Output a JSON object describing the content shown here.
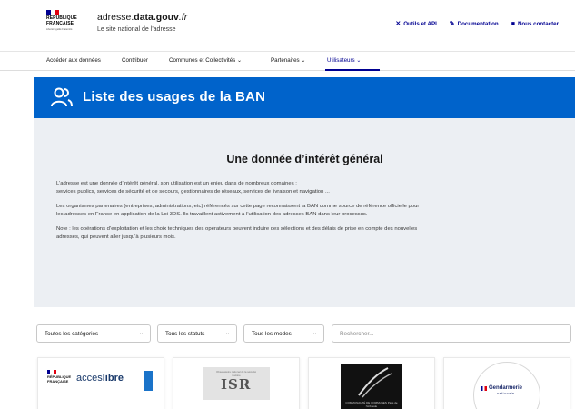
{
  "header": {
    "republic_name_line1": "RÉPUBLIQUE",
    "republic_name_line2": "FRANÇAISE",
    "motto": "Liberté Égalité Fraternité",
    "site_prefix": "adresse.",
    "site_bold": "data.gouv",
    "site_suffix": ".fr",
    "tagline": "Le site national de l'adresse",
    "links": [
      {
        "label": "Outils et API",
        "icon": "tools-icon"
      },
      {
        "label": "Documentation",
        "icon": "pen-icon"
      },
      {
        "label": "Nous contacter",
        "icon": "message-icon"
      }
    ]
  },
  "nav": {
    "items": [
      {
        "label": "Accéder aux données"
      },
      {
        "label": "Contribuer"
      },
      {
        "label": "Communes et Collectivités  ⌄"
      },
      {
        "label": "Partenaires  ⌄"
      },
      {
        "label": "Utilisateurs  ⌄"
      }
    ],
    "active_index": 4
  },
  "banner": {
    "title": "Liste des usages de la BAN",
    "icon": "users-icon",
    "color": "#0063cb"
  },
  "intro": {
    "title": "Une donnée d’intérêt général",
    "p1_line1": "L’adresse est une donnée d’intérêt général, son utilisation est un enjeu dans de nombreux domaines :",
    "p1_line2": "services publics, services de sécurité et de secours, gestionnaires de réseaux, services de livraison et navigation ...",
    "p2_line1": "Les organismes partenaires (entreprises, administrations, etc) référencés sur cette page reconnaissent la BAN comme source de référence officielle pour",
    "p2_line2": "les adresses en France en application de la Loi 3DS. Ils travaillent activement à l’utilisation des adresses BAN dans leur processus.",
    "p3_line1": "Note : les opérations d’exploitation et les choix techniques des opérateurs peuvent induire des sélections et des délais de prise en compte des nouvelles",
    "p3_line2": "adresses, qui peuvent aller jusqu’à plusieurs mois."
  },
  "filters": {
    "categories": "Toutes les catégories",
    "statuses": "Tous les statuts",
    "modes": "Tous les modes",
    "search_placeholder": "Rechercher..."
  },
  "cards": {
    "acces_libre": {
      "rf": "RÉPUBLIQUE FRANÇAISE",
      "name_normal": "acces",
      "name_bold": "libre"
    },
    "isr": {
      "header": "Observatoire national de la sécurité routière",
      "name": "ISR"
    },
    "pays": {
      "caption": "COMMUNAUTÉ DE COMMUNES Pays de l'Arbresle"
    },
    "gendarmerie": {
      "name": "Gendarmerie",
      "sub": "nationale"
    }
  },
  "colors": {
    "primary": "#000091",
    "banner": "#0063cb",
    "grey_bg": "#eceff3",
    "marianne_red": "#e1000f"
  }
}
